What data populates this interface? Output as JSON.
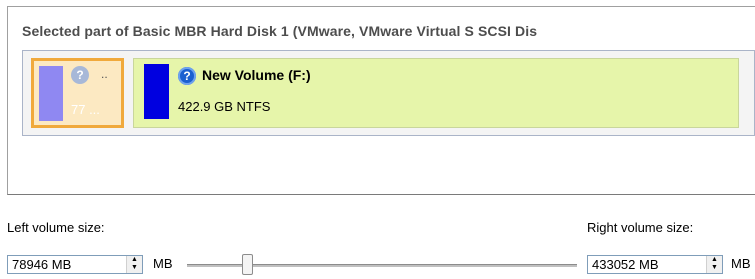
{
  "group": {
    "title": "Selected part of Basic MBR Hard Disk 1 (VMware, VMware Virtual S SCSI Dis"
  },
  "small_partition": {
    "label_dots": "..",
    "size_short": "77 ...",
    "icon": "question-icon",
    "bar_color": "#8f88f2",
    "selected_border_color": "#f0a93c"
  },
  "main_partition": {
    "name": "New Volume (F:)",
    "size_fs": "422.9 GB NTFS",
    "icon": "question-icon",
    "bar_color": "#0000e0",
    "background_color": "#e6f5aa"
  },
  "left_volume": {
    "label": "Left volume size:",
    "value": "78946 MB",
    "unit": "MB"
  },
  "right_volume": {
    "label": "Right volume size:",
    "value": "433052 MB",
    "unit": "MB"
  },
  "slider": {
    "fraction": 0.154
  }
}
